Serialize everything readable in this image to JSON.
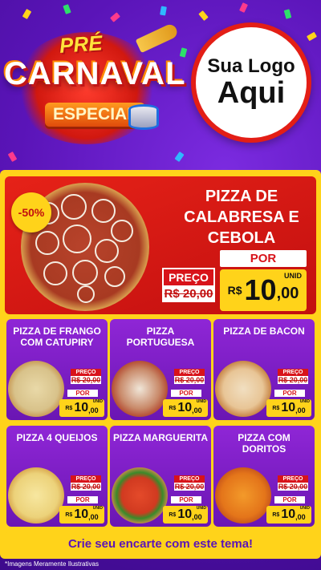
{
  "header": {
    "pre": "PRÉ",
    "carnaval": "CARNAVAL",
    "especial": "ESPECIAL",
    "logo_line1": "Sua Logo",
    "logo_line2": "Aqui"
  },
  "hero": {
    "discount": "-50%",
    "title": "PIZZA DE CALABRESA E CEBOLA",
    "preco_label": "PREÇO",
    "old_price": "R$ 20,00",
    "por_label": "POR",
    "currency": "R$",
    "price_int": "10",
    "price_dec": ",00",
    "unit": "UNID"
  },
  "cards": [
    {
      "title": "PIZZA DE FRANGO COM CATUPIRY",
      "preco_label": "PREÇO",
      "old_price": "R$ 20,00",
      "por_label": "POR",
      "currency": "R$",
      "price_int": "10",
      "price_dec": ",00",
      "unit": "UNID",
      "pizza": "frango"
    },
    {
      "title": "PIZZA PORTUGUESA",
      "preco_label": "PREÇO",
      "old_price": "R$ 20,00",
      "por_label": "POR",
      "currency": "R$",
      "price_int": "10",
      "price_dec": ",00",
      "unit": "UNID",
      "pizza": "portuguesa"
    },
    {
      "title": "PIZZA DE BACON",
      "preco_label": "PREÇO",
      "old_price": "R$ 20,00",
      "por_label": "POR",
      "currency": "R$",
      "price_int": "10",
      "price_dec": ",00",
      "unit": "UNID",
      "pizza": "bacon"
    },
    {
      "title": "PIZZA 4 QUEIJOS",
      "preco_label": "PREÇO",
      "old_price": "R$ 20,00",
      "por_label": "POR",
      "currency": "R$",
      "price_int": "10",
      "price_dec": ",00",
      "unit": "UNID",
      "pizza": "queijos"
    },
    {
      "title": "PIZZA MARGUERITA",
      "preco_label": "PREÇO",
      "old_price": "R$ 20,00",
      "por_label": "POR",
      "currency": "R$",
      "price_int": "10",
      "price_dec": ",00",
      "unit": "UNID",
      "pizza": "marguerita"
    },
    {
      "title": "PIZZA COM DORITOS",
      "preco_label": "PREÇO",
      "old_price": "R$ 20,00",
      "por_label": "POR",
      "currency": "R$",
      "price_int": "10",
      "price_dec": ",00",
      "unit": "UNID",
      "pizza": "doritos"
    }
  ],
  "cta": "Crie seu encarte com este tema!",
  "footnote": "*Imagens Meramente Ilustrativas",
  "colors": {
    "purple": "#6a16b3",
    "red": "#d8131a",
    "yellow": "#ffd31a"
  }
}
